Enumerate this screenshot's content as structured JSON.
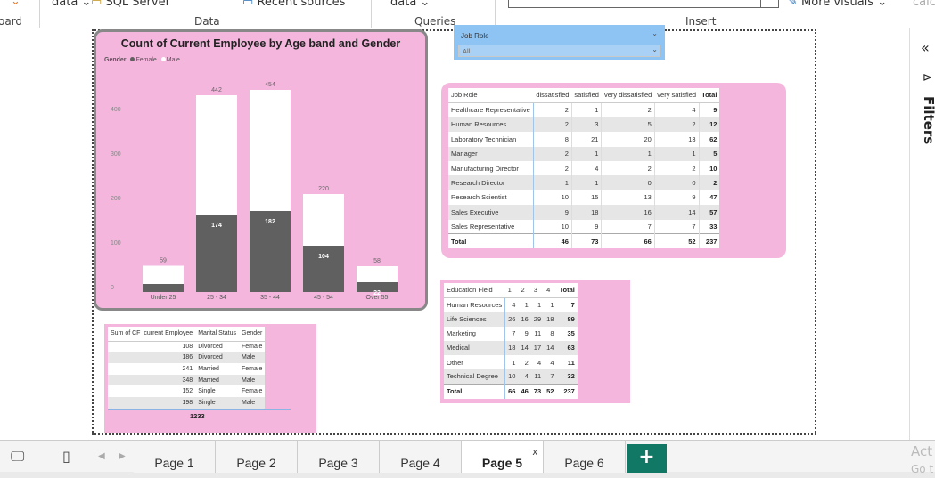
{
  "ribbon": {
    "frag_board": "oard",
    "frag_data1": "data",
    "frag_sql": "SQL Server",
    "frag_recent": "Recent sources",
    "frag_data2": "data",
    "frag_visuals": "More visuals",
    "frag_calc": "calc",
    "groups": {
      "data": "Data",
      "queries": "Queries",
      "insert": "Insert"
    }
  },
  "filters_label": "Filters",
  "chart": {
    "title": "Count of Current Employee by Age band and Gender",
    "legend_title": "Gender",
    "legend": [
      {
        "name": "Female",
        "color": "#606060"
      },
      {
        "name": "Male",
        "color": "#ffffff"
      }
    ],
    "chart_data": {
      "type": "bar",
      "stacked": true,
      "title": "Count of Current Employee by Age band and Gender",
      "categories": [
        "Under 25",
        "25 - 34",
        "35 - 44",
        "45 - 54",
        "Over 55"
      ],
      "series": [
        {
          "name": "Female",
          "values": [
            null,
            174,
            182,
            104,
            22
          ]
        },
        {
          "name": "Male",
          "values": [
            null,
            268,
            272,
            116,
            36
          ]
        }
      ],
      "totals": [
        59,
        442,
        454,
        220,
        58
      ],
      "female_labels": [
        "",
        "174",
        "182",
        "104",
        "22"
      ],
      "y_ticks": [
        0,
        100,
        200,
        300,
        400
      ],
      "ylim": [
        0,
        460
      ],
      "grid": false,
      "legend_position": "top-left"
    }
  },
  "slicer": {
    "title": "Job Role",
    "value": "All"
  },
  "job_table": {
    "headers": [
      "Job Role",
      "dissatisfied",
      "satisfied",
      "very dissatisfied",
      "very satisfied",
      "Total"
    ],
    "rows": [
      [
        "Healthcare Representative",
        "2",
        "1",
        "2",
        "4",
        "9"
      ],
      [
        "Human Resources",
        "2",
        "3",
        "5",
        "2",
        "12"
      ],
      [
        "Laboratory Technician",
        "8",
        "21",
        "20",
        "13",
        "62"
      ],
      [
        "Manager",
        "2",
        "1",
        "1",
        "1",
        "5"
      ],
      [
        "Manufacturing Director",
        "2",
        "4",
        "2",
        "2",
        "10"
      ],
      [
        "Research Director",
        "1",
        "1",
        "0",
        "0",
        "2"
      ],
      [
        "Research Scientist",
        "10",
        "15",
        "13",
        "9",
        "47"
      ],
      [
        "Sales Executive",
        "9",
        "18",
        "16",
        "14",
        "57"
      ],
      [
        "Sales Representative",
        "10",
        "9",
        "7",
        "7",
        "33"
      ]
    ],
    "total": [
      "Total",
      "46",
      "73",
      "66",
      "52",
      "237"
    ]
  },
  "edu_table": {
    "headers": [
      "Education Field",
      "1",
      "2",
      "3",
      "4",
      "Total"
    ],
    "rows": [
      [
        "Human Resources",
        "4",
        "1",
        "1",
        "1",
        "7"
      ],
      [
        "Life Sciences",
        "26",
        "16",
        "29",
        "18",
        "89"
      ],
      [
        "Marketing",
        "7",
        "9",
        "11",
        "8",
        "35"
      ],
      [
        "Medical",
        "18",
        "14",
        "17",
        "14",
        "63"
      ],
      [
        "Other",
        "1",
        "2",
        "4",
        "4",
        "11"
      ],
      [
        "Technical Degree",
        "10",
        "4",
        "11",
        "7",
        "32"
      ]
    ],
    "total": [
      "Total",
      "66",
      "46",
      "73",
      "52",
      "237"
    ]
  },
  "ms_table": {
    "headers": [
      "Sum of CF_current Employee",
      "Marital Status",
      "Gender"
    ],
    "rows": [
      [
        "108",
        "Divorced",
        "Female"
      ],
      [
        "186",
        "Divorced",
        "Male"
      ],
      [
        "241",
        "Married",
        "Female"
      ],
      [
        "348",
        "Married",
        "Male"
      ],
      [
        "152",
        "Single",
        "Female"
      ],
      [
        "198",
        "Single",
        "Male"
      ]
    ],
    "total": "1233"
  },
  "tabs": [
    "Page 1",
    "Page 2",
    "Page 3",
    "Page 4",
    "Page 5",
    "Page 6"
  ],
  "active_tab": "Page 5",
  "tab_close": "x",
  "add_tab": "+",
  "watermark": [
    "Act",
    "Go t"
  ]
}
